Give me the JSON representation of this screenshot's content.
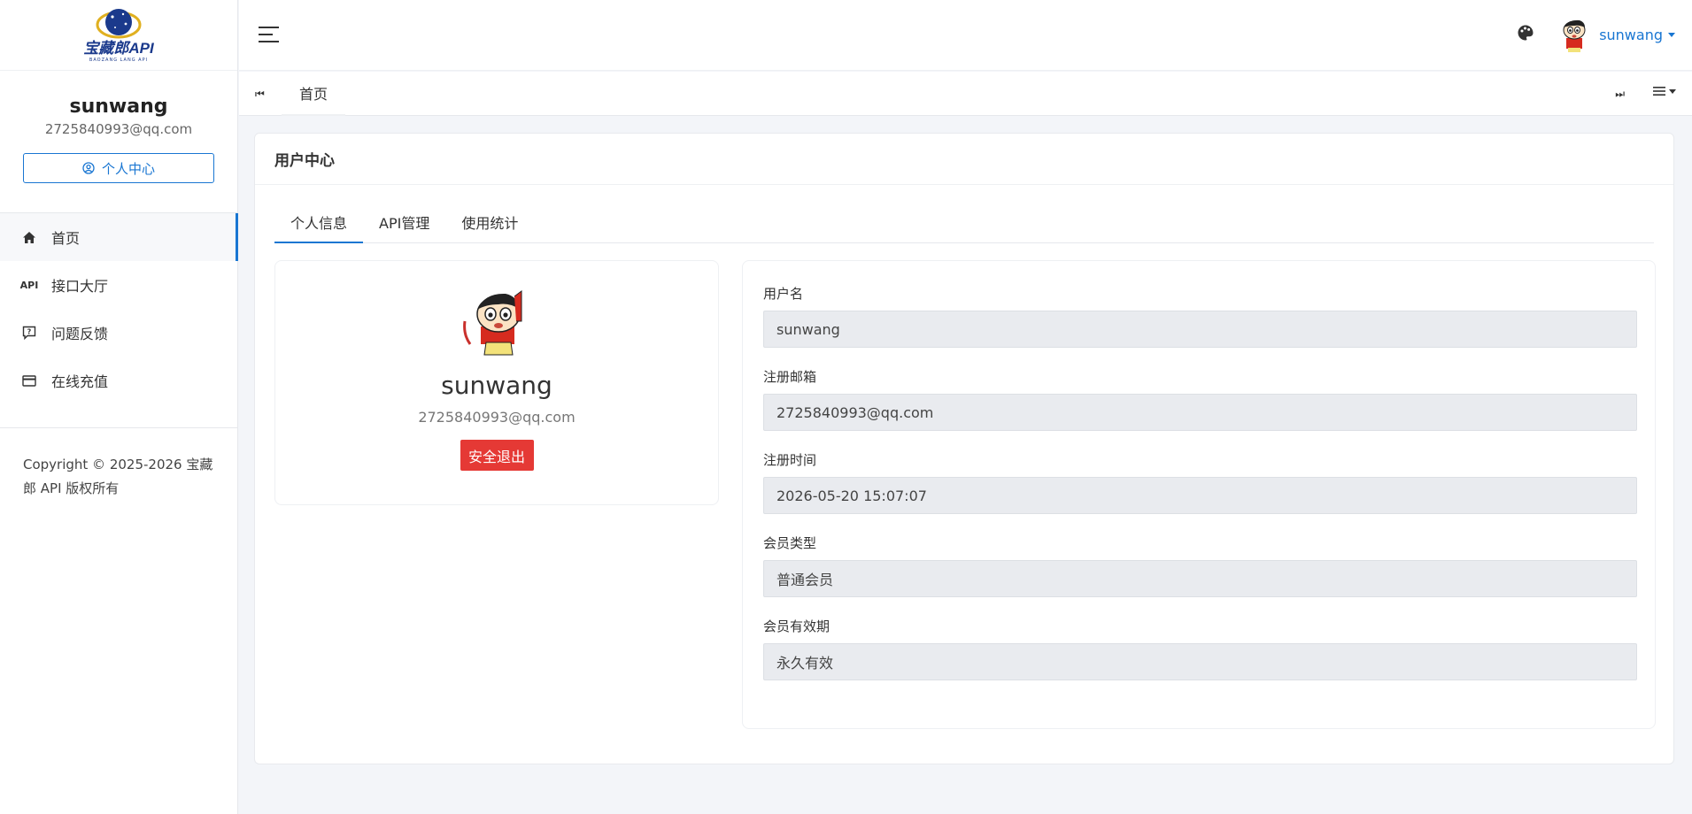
{
  "brand": {
    "logo_text": "宝藏郎API",
    "logo_sub": "BAOZANG LANG API"
  },
  "sidebar": {
    "user_name": "sunwang",
    "user_email": "2725840993@qq.com",
    "profile_button": "个人中心",
    "items": [
      {
        "label": "首页",
        "icon": "home-icon",
        "active": true
      },
      {
        "label": "接口大厅",
        "icon": "api-icon",
        "icon_text": "API"
      },
      {
        "label": "问题反馈",
        "icon": "feedback-icon"
      },
      {
        "label": "在线充值",
        "icon": "card-icon"
      }
    ],
    "copyright": "Copyright © 2025-2026 宝藏郎 API 版权所有"
  },
  "topbar": {
    "user_name": "sunwang",
    "icons": [
      "menu-icon",
      "palette-icon"
    ]
  },
  "tabsbar": {
    "home_tab": "首页"
  },
  "card": {
    "title": "用户中心",
    "tabs": [
      "个人信息",
      "API管理",
      "使用统计"
    ],
    "active_tab": 0,
    "profile": {
      "name": "sunwang",
      "email": "2725840993@qq.com",
      "logout": "安全退出"
    },
    "fields": [
      {
        "label": "用户名",
        "value": "sunwang"
      },
      {
        "label": "注册邮箱",
        "value": "2725840993@qq.com"
      },
      {
        "label": "注册时间",
        "value": "2026-05-20 15:07:07"
      },
      {
        "label": "会员类型",
        "value": "普通会员"
      },
      {
        "label": "会员有效期",
        "value": "永久有效"
      }
    ]
  },
  "colors": {
    "accent": "#1976d2",
    "danger": "#e53935",
    "input_bg": "#e9ebef"
  }
}
